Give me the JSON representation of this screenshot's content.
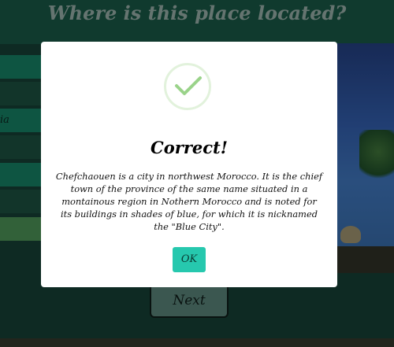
{
  "game": {
    "question": "Where is this place located?",
    "option_partial_label": "ia",
    "next_label": "Next"
  },
  "modal": {
    "icon": "check-icon",
    "title": "Correct!",
    "message": "Chefchaouen is a city in northwest Morocco. It is the chief town of the province of the same name situated in a montainous region in Nothern Morocco and is noted for its buildings in shades of blue, for which it is nicknamed the \"Blue City\".",
    "ok_label": "OK"
  },
  "colors": {
    "accent": "#26c8ae",
    "check": "#9ad38a",
    "option_highlight": "#5ca15c",
    "background": "#1b3d33"
  }
}
